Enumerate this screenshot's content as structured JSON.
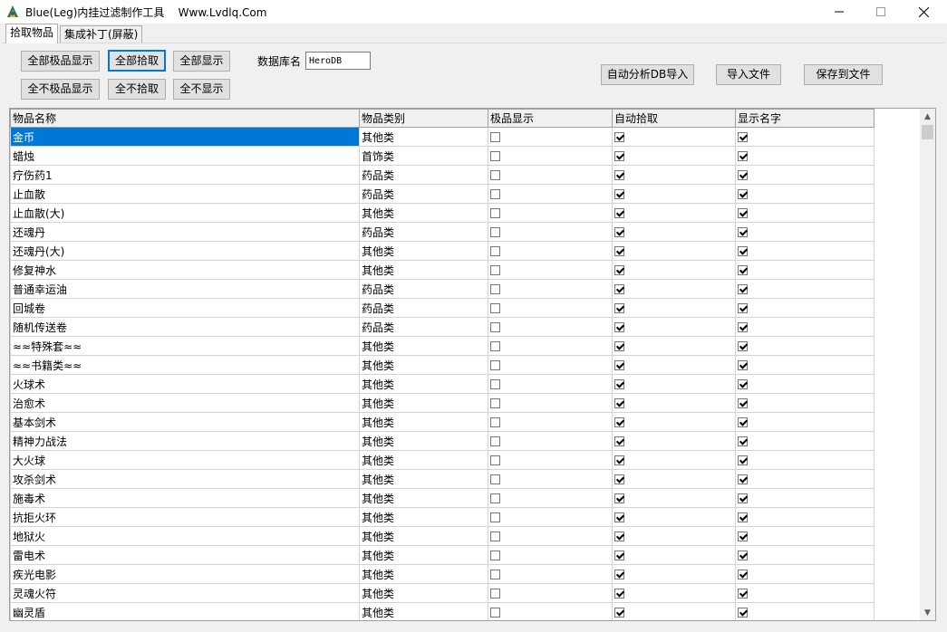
{
  "window": {
    "title": "Blue(Leg)内挂过滤制作工具    Www.Lvdlq.Com",
    "minimize": "—",
    "maximize": "☐",
    "close": "✕"
  },
  "tabs": [
    {
      "label": "拾取物品"
    },
    {
      "label": "集成补丁(屏蔽)"
    }
  ],
  "toolbar": {
    "all_fine_show": "全部极品显示",
    "all_pickup": "全部拾取",
    "all_show": "全部显示",
    "none_fine_show": "全不极品显示",
    "none_pickup": "全不拾取",
    "none_show": "全不显示",
    "db_label": "数据库名",
    "db_value": "HeroDB",
    "auto_analyze": "自动分析DB导入",
    "import_file": "导入文件",
    "save_file": "保存到文件"
  },
  "grid": {
    "columns": [
      "物品名称",
      "物品类别",
      "极品显示",
      "自动拾取",
      "显示名字"
    ],
    "rows": [
      {
        "name": "金币",
        "category": "其他类",
        "fine": false,
        "pickup": true,
        "showname": true
      },
      {
        "name": "蜡烛",
        "category": "首饰类",
        "fine": false,
        "pickup": true,
        "showname": true
      },
      {
        "name": "疗伤药1",
        "category": "药品类",
        "fine": false,
        "pickup": true,
        "showname": true
      },
      {
        "name": "止血散",
        "category": "药品类",
        "fine": false,
        "pickup": true,
        "showname": true
      },
      {
        "name": "止血散(大)",
        "category": "其他类",
        "fine": false,
        "pickup": true,
        "showname": true
      },
      {
        "name": "还魂丹",
        "category": "药品类",
        "fine": false,
        "pickup": true,
        "showname": true
      },
      {
        "name": "还魂丹(大)",
        "category": "其他类",
        "fine": false,
        "pickup": true,
        "showname": true
      },
      {
        "name": "修复神水",
        "category": "其他类",
        "fine": false,
        "pickup": true,
        "showname": true
      },
      {
        "name": "普通幸运油",
        "category": "药品类",
        "fine": false,
        "pickup": true,
        "showname": true
      },
      {
        "name": "回城卷",
        "category": "药品类",
        "fine": false,
        "pickup": true,
        "showname": true
      },
      {
        "name": "随机传送卷",
        "category": "药品类",
        "fine": false,
        "pickup": true,
        "showname": true
      },
      {
        "name": "≈≈特殊套≈≈",
        "category": "其他类",
        "fine": false,
        "pickup": true,
        "showname": true
      },
      {
        "name": "≈≈书籍类≈≈",
        "category": "其他类",
        "fine": false,
        "pickup": true,
        "showname": true
      },
      {
        "name": "火球术",
        "category": "其他类",
        "fine": false,
        "pickup": true,
        "showname": true
      },
      {
        "name": "治愈术",
        "category": "其他类",
        "fine": false,
        "pickup": true,
        "showname": true
      },
      {
        "name": "基本剑术",
        "category": "其他类",
        "fine": false,
        "pickup": true,
        "showname": true
      },
      {
        "name": "精神力战法",
        "category": "其他类",
        "fine": false,
        "pickup": true,
        "showname": true
      },
      {
        "name": "大火球",
        "category": "其他类",
        "fine": false,
        "pickup": true,
        "showname": true
      },
      {
        "name": "攻杀剑术",
        "category": "其他类",
        "fine": false,
        "pickup": true,
        "showname": true
      },
      {
        "name": "施毒术",
        "category": "其他类",
        "fine": false,
        "pickup": true,
        "showname": true
      },
      {
        "name": "抗拒火环",
        "category": "其他类",
        "fine": false,
        "pickup": true,
        "showname": true
      },
      {
        "name": "地狱火",
        "category": "其他类",
        "fine": false,
        "pickup": true,
        "showname": true
      },
      {
        "name": "雷电术",
        "category": "其他类",
        "fine": false,
        "pickup": true,
        "showname": true
      },
      {
        "name": "疾光电影",
        "category": "其他类",
        "fine": false,
        "pickup": true,
        "showname": true
      },
      {
        "name": "灵魂火符",
        "category": "其他类",
        "fine": false,
        "pickup": true,
        "showname": true
      },
      {
        "name": "幽灵盾",
        "category": "其他类",
        "fine": false,
        "pickup": true,
        "showname": true
      }
    ]
  },
  "scrollbar": {
    "up": "▲",
    "down": "▼"
  }
}
